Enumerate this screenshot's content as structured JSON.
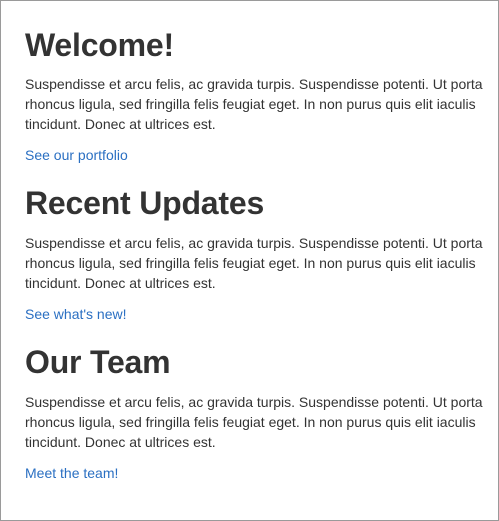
{
  "sections": [
    {
      "heading": "Welcome!",
      "paragraph": "Suspendisse et arcu felis, ac gravida turpis. Suspendisse potenti. Ut porta rhoncus ligula, sed fringilla felis feugiat eget. In non purus quis elit iaculis tincidunt. Donec at ultrices est.",
      "link": "See our portfolio"
    },
    {
      "heading": "Recent Updates",
      "paragraph": "Suspendisse et arcu felis, ac gravida turpis. Suspendisse potenti. Ut porta rhoncus ligula, sed fringilla felis feugiat eget. In non purus quis elit iaculis tincidunt. Donec at ultrices est.",
      "link": "See what's new!"
    },
    {
      "heading": "Our Team",
      "paragraph": "Suspendisse et arcu felis, ac gravida turpis. Suspendisse potenti. Ut porta rhoncus ligula, sed fringilla felis feugiat eget. In non purus quis elit iaculis tincidunt. Donec at ultrices est.",
      "link": "Meet the team!"
    }
  ],
  "colors": {
    "text": "#333333",
    "link": "#2a6fc2",
    "border": "#9a9a9a",
    "background": "#ffffff"
  }
}
